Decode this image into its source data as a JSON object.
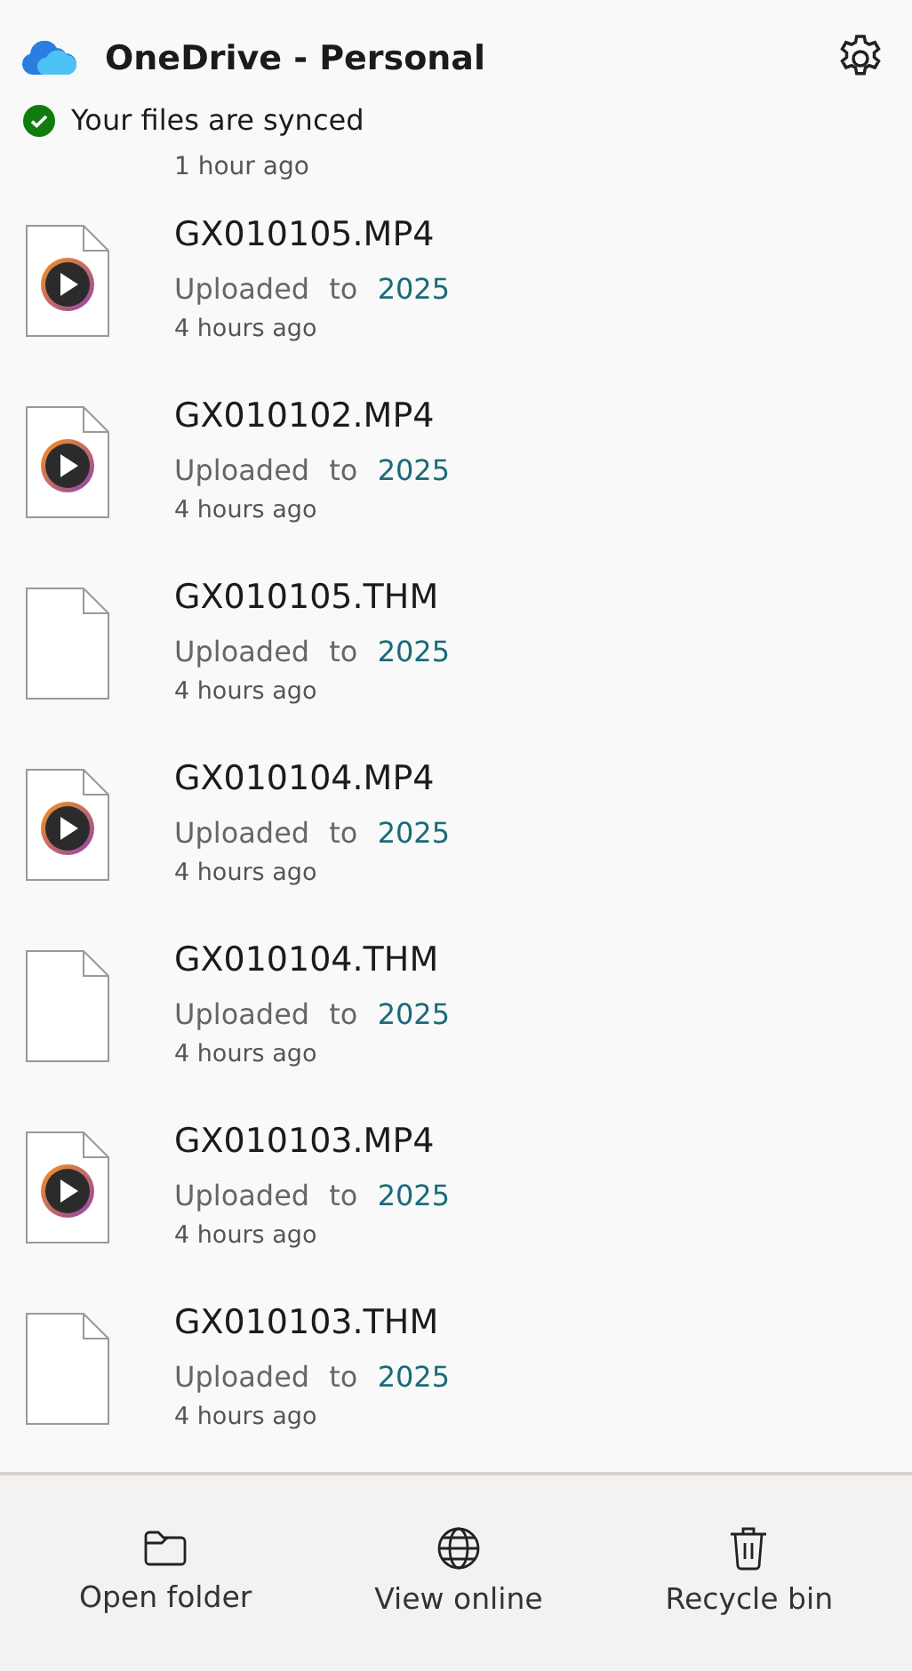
{
  "header": {
    "title": "OneDrive - Personal",
    "status": "Your files are synced",
    "synced": true
  },
  "partial_item": {
    "time": "1 hour ago"
  },
  "files": [
    {
      "name": "GX010105.MP4",
      "kind": "video",
      "action": "Uploaded",
      "prep": "to",
      "folder": "2025",
      "time": "4 hours ago"
    },
    {
      "name": "GX010102.MP4",
      "kind": "video",
      "action": "Uploaded",
      "prep": "to",
      "folder": "2025",
      "time": "4 hours ago"
    },
    {
      "name": "GX010105.THM",
      "kind": "file",
      "action": "Uploaded",
      "prep": "to",
      "folder": "2025",
      "time": "4 hours ago"
    },
    {
      "name": "GX010104.MP4",
      "kind": "video",
      "action": "Uploaded",
      "prep": "to",
      "folder": "2025",
      "time": "4 hours ago"
    },
    {
      "name": "GX010104.THM",
      "kind": "file",
      "action": "Uploaded",
      "prep": "to",
      "folder": "2025",
      "time": "4 hours ago"
    },
    {
      "name": "GX010103.MP4",
      "kind": "video",
      "action": "Uploaded",
      "prep": "to",
      "folder": "2025",
      "time": "4 hours ago"
    },
    {
      "name": "GX010103.THM",
      "kind": "file",
      "action": "Uploaded",
      "prep": "to",
      "folder": "2025",
      "time": "4 hours ago"
    }
  ],
  "footer": [
    {
      "label": "Open folder",
      "kind": "folder"
    },
    {
      "label": "View online",
      "kind": "globe"
    },
    {
      "label": "Recycle bin",
      "kind": "trash"
    }
  ]
}
